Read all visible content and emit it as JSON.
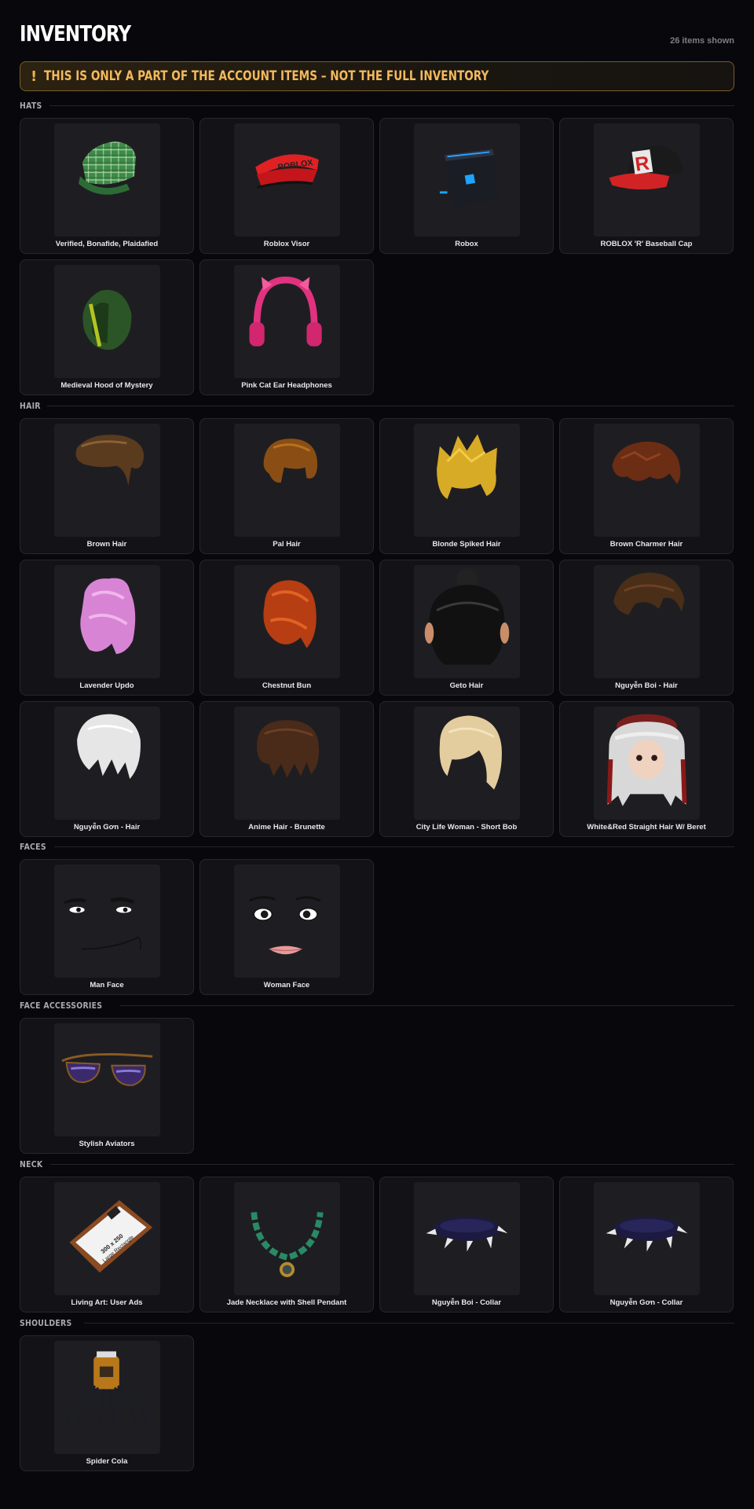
{
  "header": {
    "title": "INVENTORY",
    "count": "26 items shown"
  },
  "warning": {
    "icon": "!",
    "text": "THIS IS ONLY A PART OF THE ACCOUNT ITEMS – NOT THE FULL INVENTORY"
  },
  "colors": {
    "background": "#08080c",
    "card": "#131317",
    "accent": "#f3b95c"
  },
  "sections": {
    "hats": {
      "label": "HATS",
      "items": [
        {
          "name": "Verified, Bonafide, Plaidafied",
          "icon": "plaid-cap-icon"
        },
        {
          "name": "Roblox Visor",
          "icon": "visor-icon"
        },
        {
          "name": "Robox",
          "icon": "robox-icon"
        },
        {
          "name": "ROBLOX 'R' Baseball Cap",
          "icon": "baseball-cap-icon"
        },
        {
          "name": "Medieval Hood of Mystery",
          "icon": "hood-icon"
        },
        {
          "name": "Pink Cat Ear Headphones",
          "icon": "headphones-icon"
        }
      ]
    },
    "hair": {
      "label": "HAIR",
      "items": [
        {
          "name": "Brown Hair",
          "icon": "hair-icon"
        },
        {
          "name": "Pal Hair",
          "icon": "hair-icon"
        },
        {
          "name": "Blonde Spiked Hair",
          "icon": "hair-icon"
        },
        {
          "name": "Brown Charmer Hair",
          "icon": "hair-icon"
        },
        {
          "name": "Lavender Updo",
          "icon": "hair-icon"
        },
        {
          "name": "Chestnut Bun",
          "icon": "hair-icon"
        },
        {
          "name": "Geto Hair",
          "icon": "hair-icon"
        },
        {
          "name": "Nguyễn Boi - Hair",
          "icon": "hair-icon"
        },
        {
          "name": "Nguyễn Gơn - Hair",
          "icon": "hair-icon"
        },
        {
          "name": "Anime Hair - Brunette",
          "icon": "hair-icon"
        },
        {
          "name": "City Life Woman - Short Bob",
          "icon": "hair-icon"
        },
        {
          "name": "White&Red Straight Hair W/ Beret",
          "icon": "hair-icon"
        }
      ]
    },
    "faces": {
      "label": "FACES",
      "items": [
        {
          "name": "Man Face",
          "icon": "face-icon"
        },
        {
          "name": "Woman Face",
          "icon": "face-icon"
        }
      ]
    },
    "face_accessories": {
      "label": "FACE ACCESSORIES",
      "items": [
        {
          "name": "Stylish Aviators",
          "icon": "sunglasses-icon"
        }
      ]
    },
    "neck": {
      "label": "NECK",
      "items": [
        {
          "name": "Living Art: User Ads",
          "icon": "picture-frame-icon"
        },
        {
          "name": "Jade Necklace with Shell Pendant",
          "icon": "necklace-icon"
        },
        {
          "name": "Nguyễn Boi - Collar",
          "icon": "spiked-collar-icon"
        },
        {
          "name": "Nguyễn Gơn - Collar",
          "icon": "spiked-collar-icon"
        }
      ]
    },
    "shoulders": {
      "label": "SHOULDERS",
      "items": [
        {
          "name": "Spider Cola",
          "icon": "spider-cola-icon"
        }
      ]
    }
  }
}
